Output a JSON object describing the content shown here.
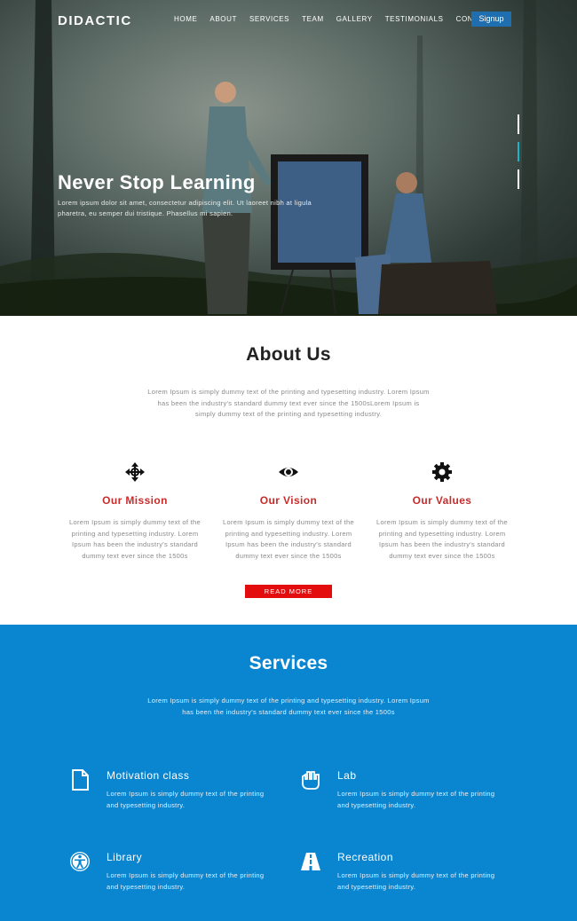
{
  "header": {
    "logo": "DIDACTIC",
    "menu": [
      {
        "label": "HOME"
      },
      {
        "label": "ABOUT"
      },
      {
        "label": "SERVICES"
      },
      {
        "label": "TEAM"
      },
      {
        "label": "GALLERY"
      },
      {
        "label": "TESTIMONIALS"
      },
      {
        "label": "CONTACT"
      }
    ],
    "signup_label": "Signup"
  },
  "hero": {
    "title": "Never Stop Learning",
    "text": "Lorem ipsum dolor sit amet, consectetur adipiscing elit. Ut laoreet nibh at ligula pharetra, eu semper dui tristique. Phasellus mi sapien."
  },
  "about": {
    "title": "About Us",
    "intro": "Lorem Ipsum is simply dummy text of the printing and typesetting industry. Lorem Ipsum has been the industry's standard dummy text ever since the 1500sLorem Ipsum is simply dummy text of the printing and typesetting industry.",
    "columns": [
      {
        "title": "Our Mission",
        "icon": "move-arrows-icon",
        "text": "Lorem Ipsum is simply dummy text of the printing and typesetting industry. Lorem Ipsum has been the industry's standard dummy text ever since the 1500s"
      },
      {
        "title": "Our Vision",
        "icon": "eye-icon",
        "text": "Lorem Ipsum is simply dummy text of the printing and typesetting industry. Lorem Ipsum has been the industry's standard dummy text ever since the 1500s"
      },
      {
        "title": "Our Values",
        "icon": "gear-icon",
        "text": "Lorem Ipsum is simply dummy text of the printing and typesetting industry. Lorem Ipsum has been the industry's standard dummy text ever since the 1500s"
      }
    ],
    "read_more_label": "READ MORE"
  },
  "services": {
    "title": "Services",
    "intro": "Lorem Ipsum is simply dummy text of the printing and typesetting industry. Lorem Ipsum has been the industry's standard dummy text ever since the 1500s",
    "items": [
      {
        "title": "Motivation class",
        "icon": "document-icon",
        "text": "Lorem Ipsum is simply dummy text of the printing and typesetting industry."
      },
      {
        "title": "Lab",
        "icon": "glove-icon",
        "text": "Lorem Ipsum is simply dummy text of the printing and typesetting industry."
      },
      {
        "title": "Library",
        "icon": "accessibility-icon",
        "text": "Lorem Ipsum is simply dummy text of the printing and typesetting industry."
      },
      {
        "title": "Recreation",
        "icon": "road-icon",
        "text": "Lorem Ipsum is simply dummy text of the printing and typesetting industry."
      }
    ]
  },
  "colors": {
    "accent_red": "#e40d0d",
    "title_red": "#c92b2b",
    "services_blue": "#0a86d1",
    "signup_blue": "#1f6fb0"
  }
}
